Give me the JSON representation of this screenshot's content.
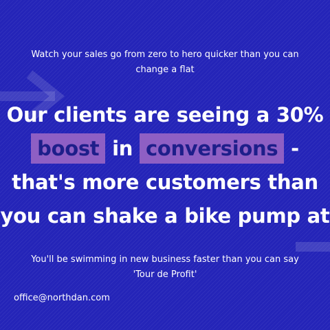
{
  "intro": {
    "line1": "Watch your sales go from zero to hero quicker than you can",
    "line2": "change a flat"
  },
  "headline": {
    "line1": "Our clients are seeing a 30%",
    "highlight1": "boost",
    "connector": "in",
    "highlight2": "conversions",
    "dash": "-",
    "line3": "that's more customers than",
    "line4": "you can shake a bike pump at"
  },
  "closing": {
    "line1": "You'll be swimming in new business faster than you can say",
    "line2": "'Tour de Profit'"
  },
  "contact": {
    "email": "office@northdan.com"
  },
  "colors": {
    "background": "#2424b8",
    "highlight": "#8e5fc4",
    "highlight_text": "#1e1e8a",
    "text": "#ffffff"
  }
}
